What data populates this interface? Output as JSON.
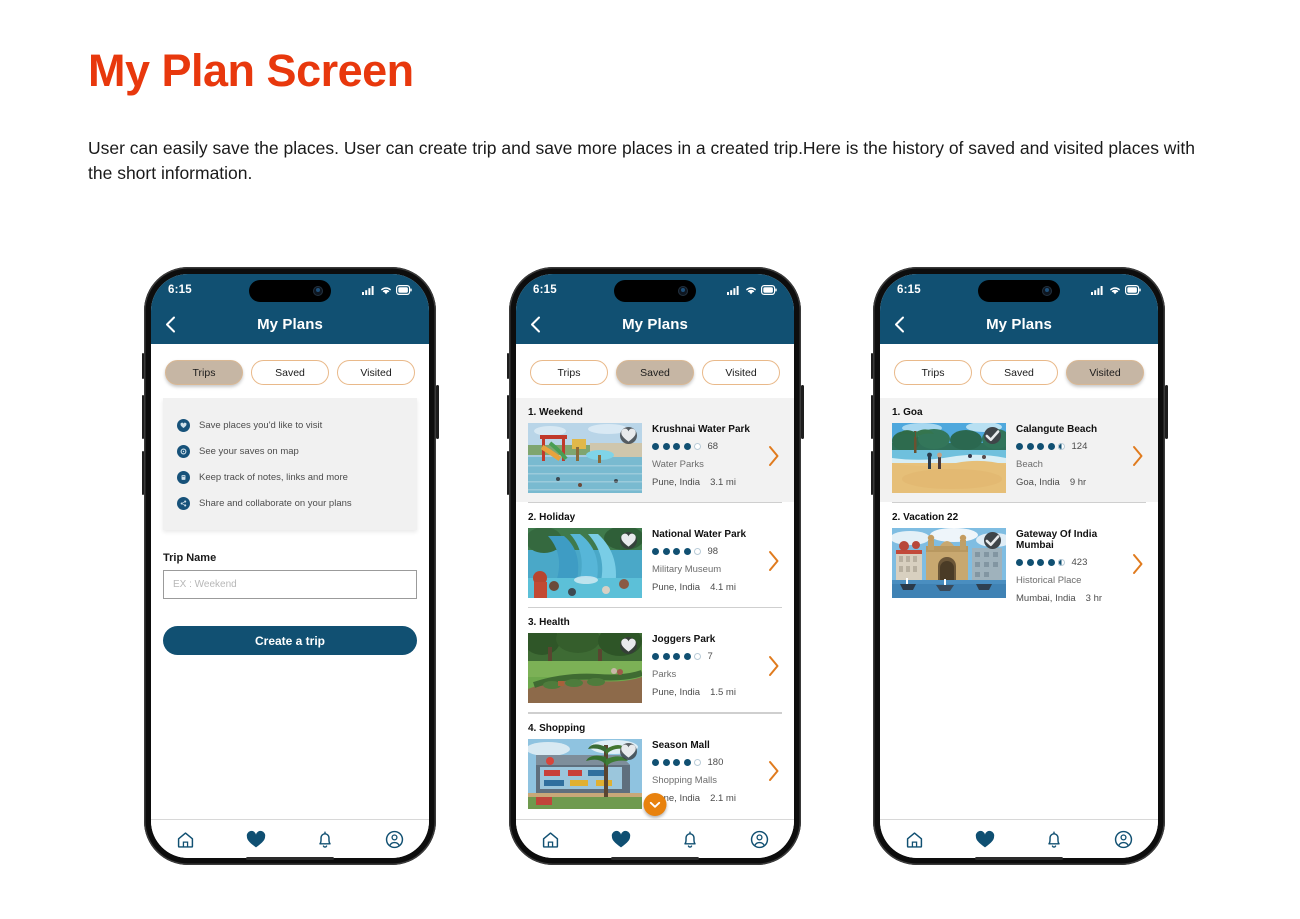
{
  "slide": {
    "title": "My Plan Screen",
    "description": "User can easily save the places. User can create trip and save more places in a created trip.Here is the history of saved and visited places with the short information.",
    "accent_color": "#e8380d"
  },
  "status_bar": {
    "time": "6:15",
    "signal_icon": "signal-bars-icon",
    "wifi_icon": "wifi-icon",
    "battery_icon": "battery-icon"
  },
  "nav": {
    "back_icon": "chevron-left-icon",
    "title": "My Plans"
  },
  "tabs": [
    {
      "label": "Trips"
    },
    {
      "label": "Saved"
    },
    {
      "label": "Visited"
    }
  ],
  "bottom_nav": [
    {
      "icon": "home-icon",
      "label": "Home"
    },
    {
      "icon": "heart-icon",
      "label": "Favorites"
    },
    {
      "icon": "bell-icon",
      "label": "Notifications"
    },
    {
      "icon": "profile-icon",
      "label": "Profile"
    }
  ],
  "screen_trips": {
    "active_tab": "Trips",
    "features": [
      {
        "icon": "save-heart-icon",
        "text": "Save places you'd like to visit"
      },
      {
        "icon": "map-pin-icon",
        "text": "See your saves on map"
      },
      {
        "icon": "note-icon",
        "text": "Keep track of notes, links and more"
      },
      {
        "icon": "share-icon",
        "text": "Share and collaborate on your plans"
      }
    ],
    "field_label": "Trip Name",
    "field_value": "",
    "field_placeholder": "EX : Weekend",
    "cta_label": "Create a trip"
  },
  "screen_saved": {
    "active_tab": "Saved",
    "groups": [
      {
        "title": "1. Weekend",
        "highlighted": true,
        "place": {
          "name": "Krushnai Water Park",
          "rating_filled": 4,
          "rating_half": false,
          "rating_total": 5,
          "rating_count": "68",
          "category": "Water Parks",
          "location": "Pune, India",
          "distance": "3.1 mi",
          "badge_icon": "heart-icon",
          "image": "waterpark-slides"
        }
      },
      {
        "title": "2. Holiday",
        "highlighted": false,
        "place": {
          "name": "National Water Park",
          "rating_filled": 4,
          "rating_half": false,
          "rating_total": 5,
          "rating_count": "98",
          "category": "Military Museum",
          "location": "Pune, India",
          "distance": "4.1 mi",
          "badge_icon": "heart-icon",
          "image": "waterpark-blue-slides"
        }
      },
      {
        "title": "3. Health",
        "highlighted": false,
        "place": {
          "name": "Joggers Park",
          "rating_filled": 4,
          "rating_half": false,
          "rating_total": 5,
          "rating_count": "7",
          "category": "Parks",
          "location": "Pune, India",
          "distance": "1.5 mi",
          "badge_icon": "heart-icon",
          "image": "green-park"
        }
      },
      {
        "title": "4. Shopping",
        "highlighted": false,
        "place": {
          "name": "Season Mall",
          "rating_filled": 4,
          "rating_half": false,
          "rating_total": 5,
          "rating_count": "180",
          "category": "Shopping Malls",
          "location": "Pune, India",
          "distance": "2.1 mi",
          "badge_icon": "heart-icon",
          "image": "mall-building"
        }
      }
    ],
    "scroll_indicator_icon": "chevron-down-icon"
  },
  "screen_visited": {
    "active_tab": "Visited",
    "groups": [
      {
        "title": "1. Goa",
        "highlighted": true,
        "place": {
          "name": "Calangute Beach",
          "rating_filled": 4,
          "rating_half": true,
          "rating_total": 5,
          "rating_count": "124",
          "category": "Beach",
          "location": "Goa, India",
          "distance": "9 hr",
          "badge_icon": "check-icon",
          "image": "beach-palms"
        }
      },
      {
        "title": "2. Vacation 22",
        "highlighted": false,
        "place": {
          "name": "Gateway Of India Mumbai",
          "rating_filled": 4,
          "rating_half": true,
          "rating_total": 5,
          "rating_count": "423",
          "category": "Historical Place",
          "location": "Mumbai, India",
          "distance": "3 hr",
          "badge_icon": "check-icon",
          "image": "gateway-of-india"
        }
      }
    ]
  }
}
